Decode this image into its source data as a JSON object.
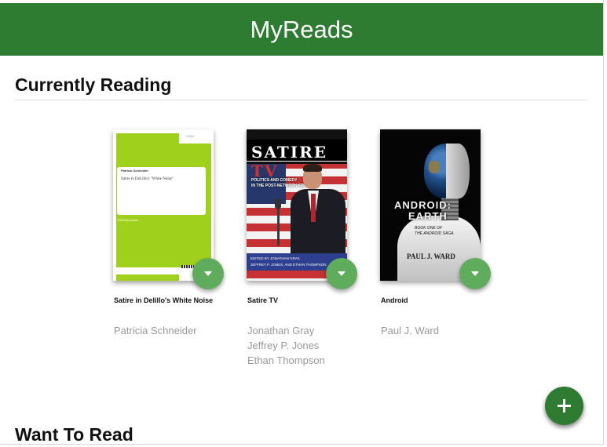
{
  "header": {
    "title": "MyReads"
  },
  "shelves": [
    {
      "title": "Currently Reading",
      "books": [
        {
          "title": "Satire in Delillo's White Noise",
          "authors": [
            "Patricia Schneider"
          ],
          "cover": {
            "author_text": "Patricia Schneider",
            "title_text": "Satire in DeLillo's \"White Noise\"",
            "label_text": "Seminar paper",
            "publisher_text": "GRIN"
          }
        },
        {
          "title": "Satire TV",
          "authors": [
            "Jonathan Gray",
            "Jeffrey P. Jones",
            "Ethan Thompson"
          ],
          "cover": {
            "title_main": "SATIRE ",
            "title_accent": "TV",
            "subtitle_line1": "POLITICS AND COMEDY",
            "subtitle_line2": "IN THE POST-NETWORK ERA",
            "editors_line1": "EDITED BY JONATHAN GRAY,",
            "editors_line2": "JEFFREY P. JONES, AND ETHAN THOMPSON"
          }
        },
        {
          "title": "Android",
          "authors": [
            "Paul J. Ward"
          ],
          "cover": {
            "title_line1": "ANDROID:",
            "title_line2": "EARTH",
            "sub_line1": "BOOK ONE OF",
            "sub_line2": "THE ANDROID SAGA",
            "author_text": "PAUL J. WARD"
          }
        }
      ]
    },
    {
      "title": "Want To Read"
    }
  ],
  "colors": {
    "header_bg": "#2e7c31",
    "shelf_changer": "#60ac5d",
    "add_button": "#2e7c31",
    "author_text": "#999999"
  },
  "icons": {
    "shelf_changer": "chevron-down-icon",
    "add_book": "plus-icon"
  }
}
